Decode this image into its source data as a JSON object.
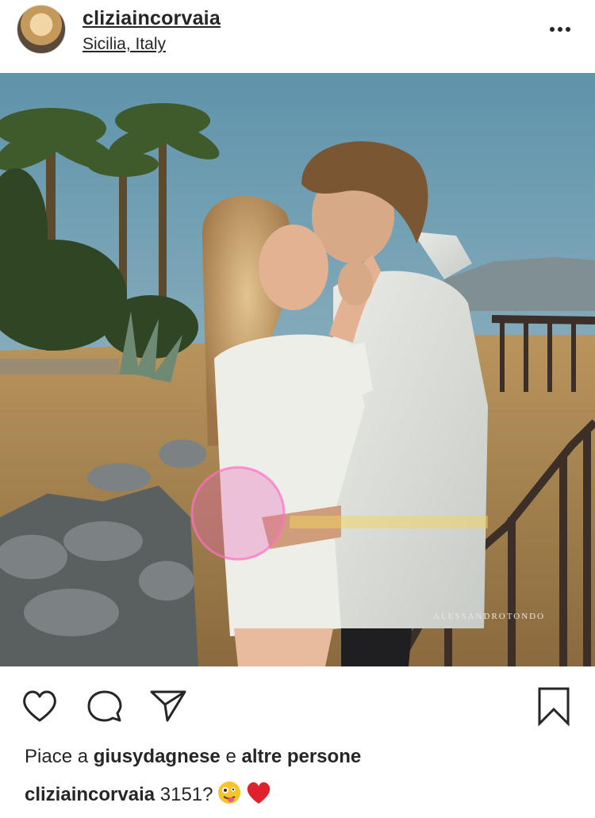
{
  "post": {
    "username": "cliziaincorvaia",
    "location": "Sicilia, Italy",
    "photo_credit": "ALESSANDROTONDO"
  },
  "likes": {
    "prefix": "Piace a ",
    "user": "giusydagnese",
    "middle": " e ",
    "others": "altre persone"
  },
  "caption": {
    "username": "cliziaincorvaia",
    "text": " 3151?"
  },
  "icons": {
    "more": "more-dots-icon",
    "like": "heart-outline-icon",
    "comment": "comment-bubble-icon",
    "share": "paper-plane-icon",
    "save": "bookmark-icon",
    "emoji_1": "zany-face-emoji",
    "emoji_2": "red-heart-emoji"
  },
  "colors": {
    "text": "#262626",
    "heart": "#e0202d",
    "sky": "#5e8ea6"
  }
}
